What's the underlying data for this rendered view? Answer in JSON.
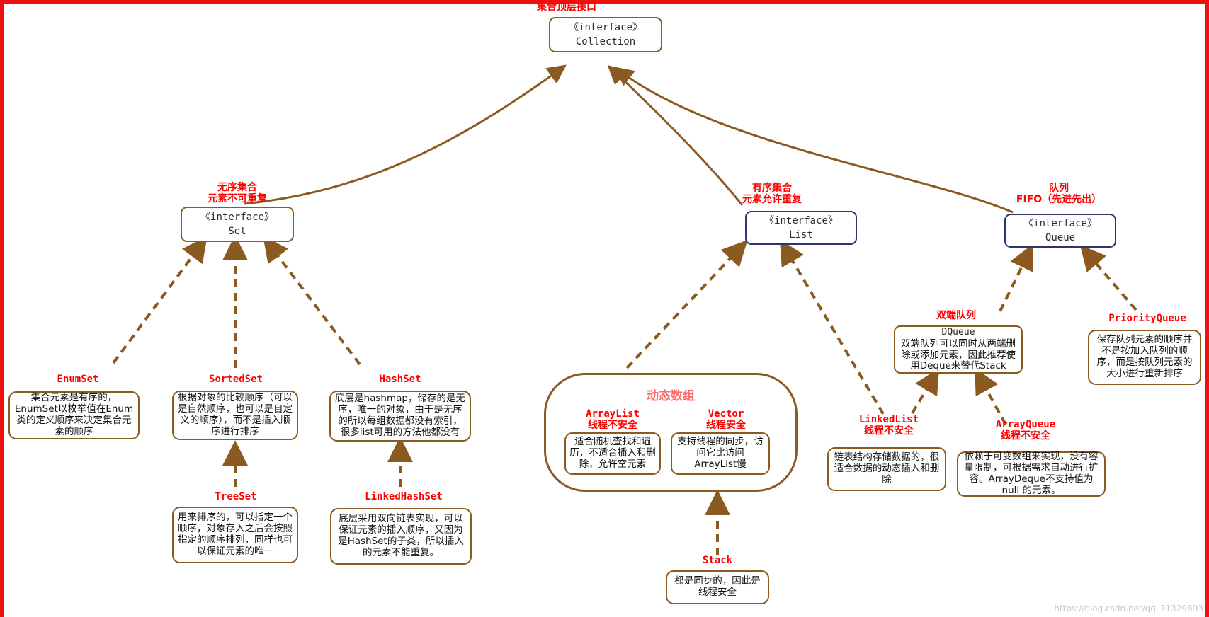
{
  "diagram": {
    "title_top": "集合顶层接口",
    "watermark": "https://blog.csdn.net/qq_31329893"
  },
  "nodes": {
    "collection": {
      "stereotype": "《interface》",
      "name": "Collection"
    },
    "set": {
      "stereotype": "《interface》",
      "name": "Set"
    },
    "list": {
      "stereotype": "《interface》",
      "name": "List"
    },
    "queue": {
      "stereotype": "《interface》",
      "name": "Queue"
    }
  },
  "captions": {
    "set": "无序集合\n元素不可重复",
    "list": "有序集合\n元素允许重复",
    "queue": "队列\nFIFO（先进先出）",
    "enumset": "EnumSet",
    "sortedset": "SortedSet",
    "hashset": "HashSet",
    "treeset": "TreeSet",
    "linkedhashset": "LinkedHashSet",
    "arraylist": "ArrayList\n线程不安全",
    "vector": "Vector\n线程安全",
    "stack": "Stack",
    "linkedlist": "LinkedList\n线程不安全",
    "arrayqueue": "ArrayQueue\n线程不安全",
    "dqueue_zh": "双端队列",
    "priorityqueue": "PriorityQueue",
    "group_dynamic_array": "动态数组",
    "dqueue_name": "DQueue"
  },
  "notes": {
    "enumset": "集合元素是有序的，EnumSet以枚举值在Enum类的定义顺序来决定集合元素的顺序",
    "sortedset": "根据对象的比较顺序（可以是自然顺序，也可以是自定义的顺序），而不是插入顺序进行排序",
    "hashset": "底层是hashmap，储存的是无序，唯一的对象，由于是无序的所以每组数据都没有索引，很多list可用的方法他都没有",
    "treeset": "用来排序的，可以指定一个顺序，对象存入之后会按照指定的顺序排列，同样也可以保证元素的唯一",
    "linkedhashset": "底层采用双向链表实现，可以保证元素的插入顺序，又因为是HashSet的子类，所以插入的元素不能重复。",
    "arraylist": "适合随机查找和遍历，不适合插入和删除，允许空元素",
    "vector": "支持线程的同步，访问它比访问ArrayList慢",
    "stack": "都是同步的，因此是线程安全",
    "linkedlist": "链表结构存储数据的，很适合数据的动态插入和删除",
    "dqueue": "双端队列可以同时从两端删除或添加元素，因此推荐使用Deque来替代Stack",
    "arrayqueue": "依赖于可变数组来实现，没有容量限制，可根据需求自动进行扩容。ArrayDeque不支持值为 null 的元素。",
    "priorityqueue": "保存队列元素的顺序并不是按加入队列的顺序，而是按队列元素的大小进行重新排序"
  },
  "colors": {
    "accent_red": "#ff0000",
    "border_brown": "#8a5a20",
    "border_navy": "#2c3570",
    "group_title": "#ff6a6a",
    "frame_red": "#ee1111"
  }
}
